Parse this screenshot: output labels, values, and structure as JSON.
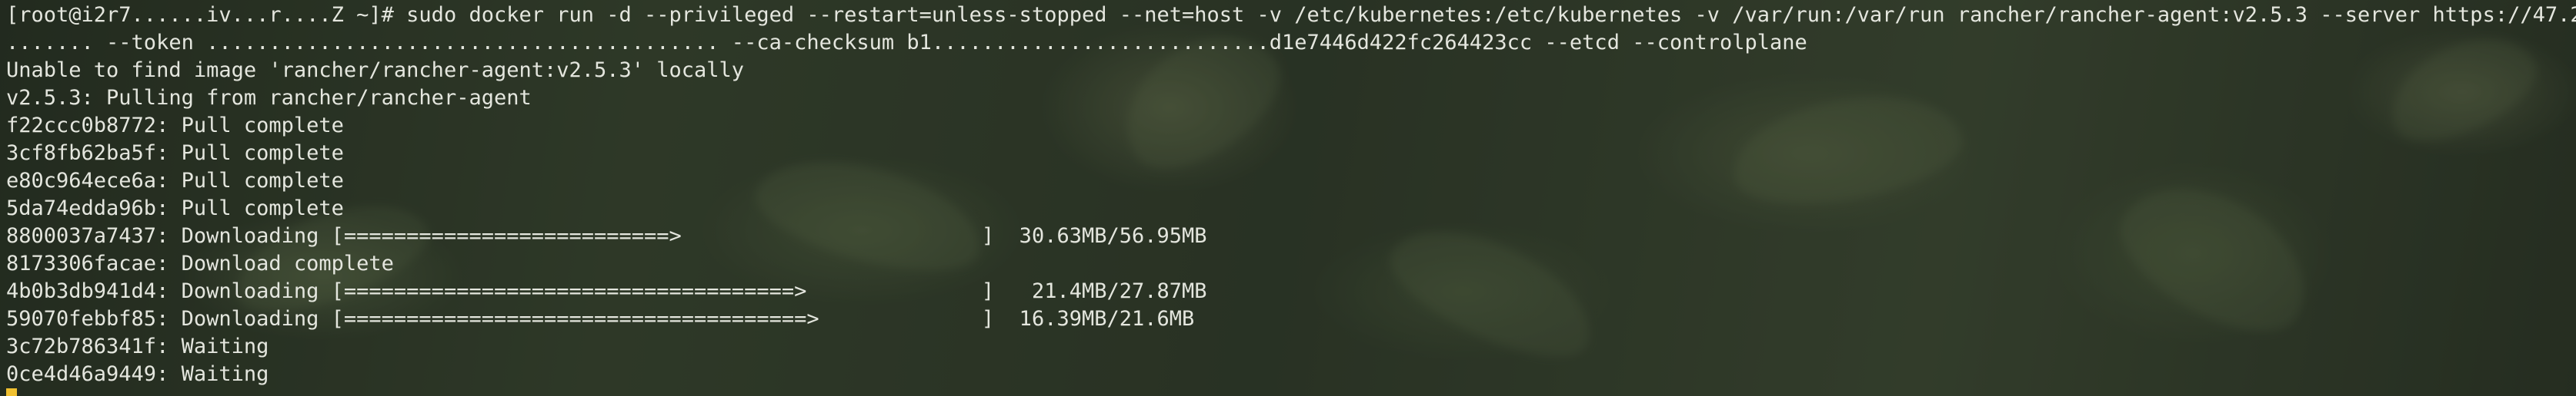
{
  "terminal": {
    "lines": [
      "[root@i2r7......iv...r....Z ~]# sudo docker run -d --privileged --restart=unless-stopped --net=host -v /etc/kubernetes:/etc/kubernetes -v /var/run:/var/run rancher/rancher-agent:v2.5.3 --server https://47.2",
      "....... --token ......................................... --ca-checksum b1...........................d1e7446d422fc264423cc --etcd --controlplane",
      "Unable to find image 'rancher/rancher-agent:v2.5.3' locally",
      "v2.5.3: Pulling from rancher/rancher-agent",
      "f22ccc0b8772: Pull complete",
      "3cf8fb62ba5f: Pull complete",
      "e80c964ece6a: Pull complete",
      "5da74edda96b: Pull complete",
      "8800037a7437: Downloading [==========================>                        ]  30.63MB/56.95MB",
      "8173306facae: Download complete",
      "4b0b3db941d4: Downloading [====================================>              ]   21.4MB/27.87MB",
      "59070febbf85: Downloading [=====================================>             ]  16.39MB/21.6MB",
      "3c72b786341f: Waiting",
      "0ce4d46a9449: Waiting"
    ],
    "cursor_color": "#f0c030"
  }
}
